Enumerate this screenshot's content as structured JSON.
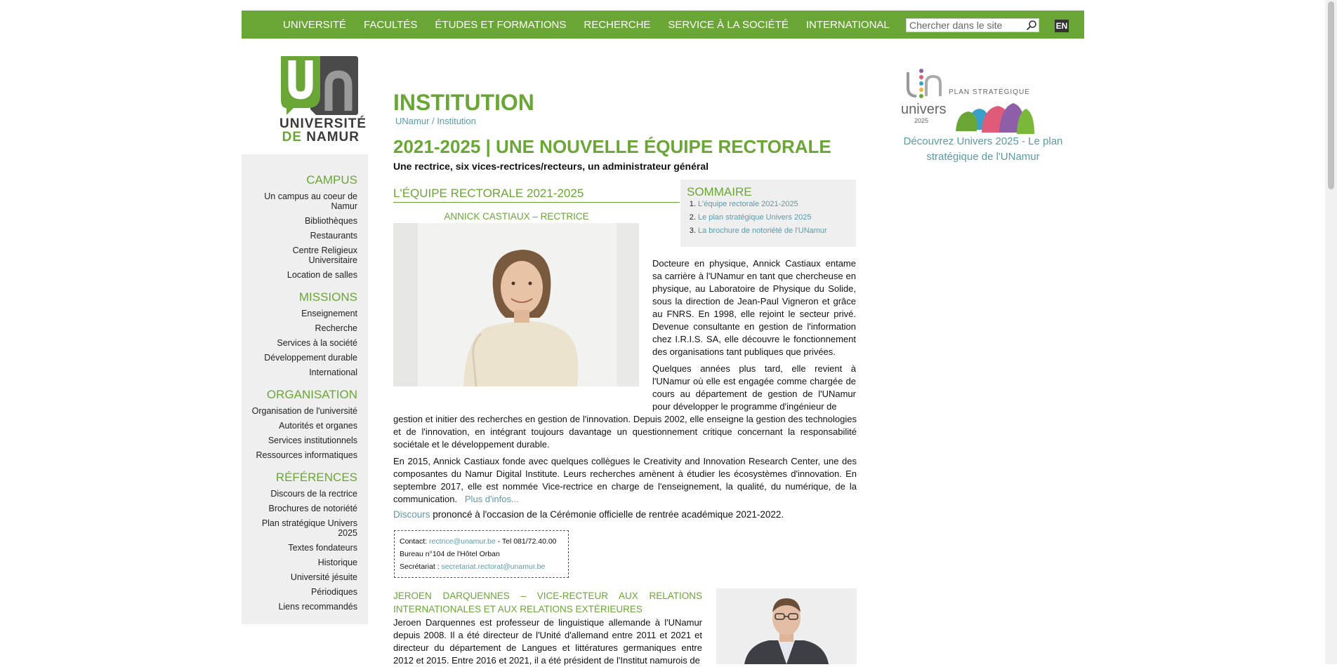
{
  "nav": {
    "items": [
      "UNIVERSITÉ",
      "FACULTÉS",
      "ÉTUDES ET FORMATIONS",
      "RECHERCHE",
      "SERVICE À LA SOCIÉTÉ",
      "INTERNATIONAL"
    ],
    "search_placeholder": "Chercher dans le site",
    "lang": "EN"
  },
  "logo": {
    "line1": "UNIVERSITÉ",
    "line2_a": "DE",
    "line2_b": "NAMUR"
  },
  "sidebar": {
    "sections": [
      {
        "title": "CAMPUS",
        "items": [
          "Un campus au coeur de Namur",
          "Bibliothèques",
          "Restaurants",
          "Centre Religieux Universitaire",
          "Location de salles"
        ]
      },
      {
        "title": "MISSIONS",
        "items": [
          "Enseignement",
          "Recherche",
          "Services à la société",
          "Développement durable",
          "International"
        ]
      },
      {
        "title": "ORGANISATION",
        "items": [
          "Organisation de l'université",
          "Autorités et organes",
          "Services institutionnels",
          "Ressources informatiques"
        ]
      },
      {
        "title": "RÉFÉRENCES",
        "items": [
          "Discours de la rectrice",
          "Brochures de notoriété",
          "Plan stratégique Univers 2025",
          "Textes fondateurs",
          "Historique",
          "Université jésuite",
          "Périodiques",
          "Liens recommandés"
        ]
      }
    ]
  },
  "main": {
    "section_title": "INSTITUTION",
    "breadcrumb": {
      "home": "UNamur",
      "sep": " / ",
      "current": "Institution"
    },
    "page_title": "2021-2025 | UNE NOUVELLE ÉQUIPE RECTORALE",
    "subtitle": "Une rectrice, six vices-rectrices/recteurs, un administrateur général",
    "section_heading": "L'ÉQUIPE RECTORALE 2021-2025",
    "castiaux_name": "ANNICK CASTIAUX – RECTRICE",
    "summary": {
      "title": "SOMMAIRE",
      "items": [
        "L'équipe rectorale 2021-2025",
        "Le plan stratégique Univers 2025",
        "La brochure de notoriété de l'UNamur"
      ]
    },
    "p1": "Docteure en physique, Annick Castiaux entame sa carrière à l'UNamur en tant que chercheuse en physique, au Laboratoire de Physique du Solide, sous la direction de Jean-Paul Vigneron et grâce au FNRS. En 1998, elle rejoint le secteur privé. Devenue consultante en gestion de l'information chez I.R.I.S. SA, elle découvre le fonctionnement des organisations tant publiques que privées.",
    "p2_top": "Quelques années plus tard, elle revient à l'UNamur où elle est engagée comme chargée de cours au département de gestion de l'UNamur pour développer le programme d'ingénieur de",
    "p2_bottom": "gestion et initier des recherches en gestion de l'innovation. Depuis 2002, elle enseigne la gestion des technologies et de l'innovation, en intégrant toujours davantage un questionnement critique concernant la responsabilité sociétale et le développement durable.",
    "p3": "En 2015, Annick Castiaux fonde avec quelques collègues le Creativity and Innovation Research Center, une des composantes du Namur Digital Institute. Leurs recherches amènent à étudier les écosystèmes d'innovation. En septembre 2017, elle est nommée Vice-rectrice en charge de l'enseignement, la qualité, du numérique, de la communication.",
    "plus_infos": "Plus d'infos...",
    "p4_link": "Discours",
    "p4_text": " prononcé à l'occasion de la Cérémonie officielle de rentrée académique 2021-2022.",
    "contact": {
      "label": "Contact: ",
      "email": "rectrice@unamur.be",
      "tel": " - Tel 081/72.40.00",
      "bureau": "Bureau n°104 de l'Hôtel Orban",
      "secr_label": "Secrétariat : ",
      "secr_email": "secretariat.rectorat@unamur.be"
    },
    "jeroen_name": "JEROEN DARQUENNES – VICE-RECTEUR AUX RELATIONS INTERNATIONALES ET AUX RELATIONS EXTÉRIEURES",
    "p5": "Jeroen Darquennes est professeur de linguistique allemande à l'UNamur depuis 2008. Il a été directeur de l'Unité d'allemand entre 2011 et 2021 et directeur du département de Langues et littératures germaniques entre 2012 et 2015. Entre 2016 et 2021, il a été président de l'Institut namurois de"
  },
  "banner": {
    "plan_label": "PLAN STRATÉGIQUE",
    "univers_word": "univers",
    "year": "2025",
    "caption": "Découvrez Univers 2025 - Le plan stratégique de l'UNamur"
  },
  "colors": {
    "brand_green": "#6aa635",
    "link": "#5a9aa8",
    "sidebar_bg": "#efefef"
  }
}
